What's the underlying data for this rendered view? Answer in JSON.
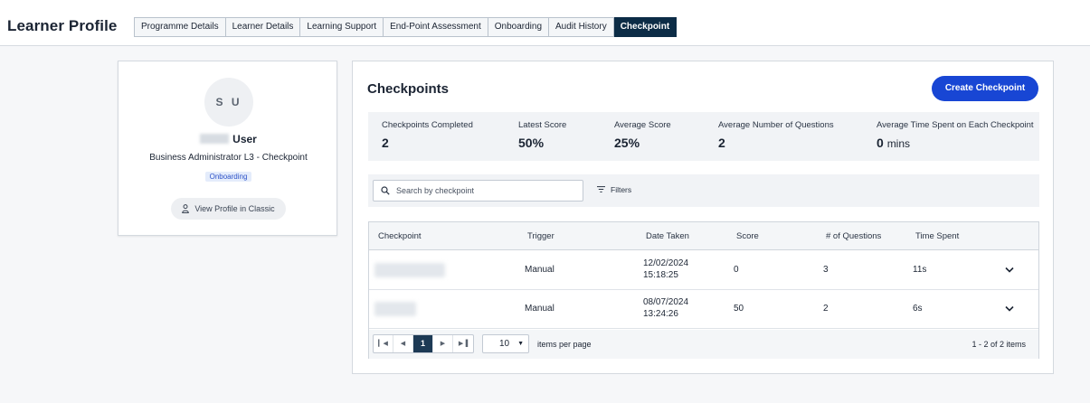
{
  "header": {
    "title": "Learner Profile",
    "tabs": [
      {
        "label": "Programme Details"
      },
      {
        "label": "Learner Details"
      },
      {
        "label": "Learning Support"
      },
      {
        "label": "End-Point Assessment"
      },
      {
        "label": "Onboarding"
      },
      {
        "label": "Audit History"
      },
      {
        "label": "Checkpoint"
      }
    ],
    "active_tab": "Checkpoint"
  },
  "profile": {
    "initials": "S U",
    "name": "User",
    "programme": "Business Administrator L3 - Checkpoint",
    "status_badge": "Onboarding",
    "classic_button": "View Profile in Classic"
  },
  "checkpoints": {
    "title": "Checkpoints",
    "create_button": "Create Checkpoint",
    "stats": [
      {
        "label": "Checkpoints Completed",
        "value": "2"
      },
      {
        "label": "Latest Score",
        "value": "50%"
      },
      {
        "label": "Average Score",
        "value": "25%"
      },
      {
        "label": "Average Number of Questions",
        "value": "2"
      },
      {
        "label": "Average Time Spent on Each Checkpoint",
        "value": "0",
        "unit": "mins"
      }
    ],
    "search": {
      "placeholder": "Search by checkpoint",
      "value": ""
    },
    "filters_label": "Filters",
    "columns": [
      "Checkpoint",
      "Trigger",
      "Date Taken",
      "Score",
      "# of Questions",
      "Time Spent"
    ],
    "rows": [
      {
        "checkpoint": "",
        "trigger": "Manual",
        "date": "12/02/2024",
        "time": "15:18:25",
        "score": "0",
        "questions": "3",
        "time_spent": "11s"
      },
      {
        "checkpoint": "",
        "trigger": "Manual",
        "date": "08/07/2024",
        "time": "13:24:26",
        "score": "50",
        "questions": "2",
        "time_spent": "6s"
      }
    ],
    "pagination": {
      "current_page": "1",
      "page_size": "10",
      "per_page_label": "items per page",
      "range": "1 - 2 of 2 items"
    }
  },
  "colors": {
    "accent": "#1846d4",
    "active_tab": "#0c2c46",
    "badge_bg": "#e4ecfb",
    "badge_text": "#2f54c8"
  }
}
